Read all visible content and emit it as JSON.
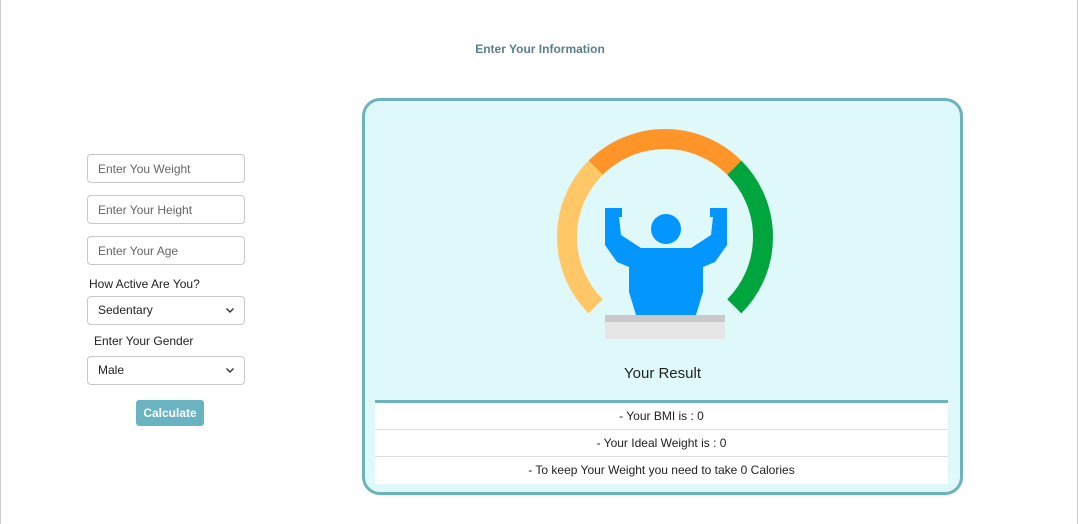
{
  "page": {
    "title": "Enter Your Information"
  },
  "form": {
    "weight_placeholder": "Enter You Weight",
    "height_placeholder": "Enter Your Height",
    "age_placeholder": "Enter Your Age",
    "activity_label": "How Active Are You?",
    "activity_value": "Sedentary",
    "gender_label": "Enter Your Gender",
    "gender_value": "Male",
    "calculate_label": "Calculate"
  },
  "result": {
    "title": "Your Result",
    "rows": [
      "- Your BMI is : 0",
      "- Your Ideal Weight is : 0",
      "- To keep Your Weight you need to take 0 Calories"
    ]
  },
  "colors": {
    "accent": "#6cb3c1",
    "card_background": "#dff9fa",
    "gauge_yellow": "#ffc766",
    "gauge_orange": "#ff9428",
    "gauge_green": "#00a53d",
    "figure_blue": "#0496ff"
  },
  "icons": {
    "gauge": "bmi-gauge-icon",
    "figure": "strong-man-icon"
  }
}
